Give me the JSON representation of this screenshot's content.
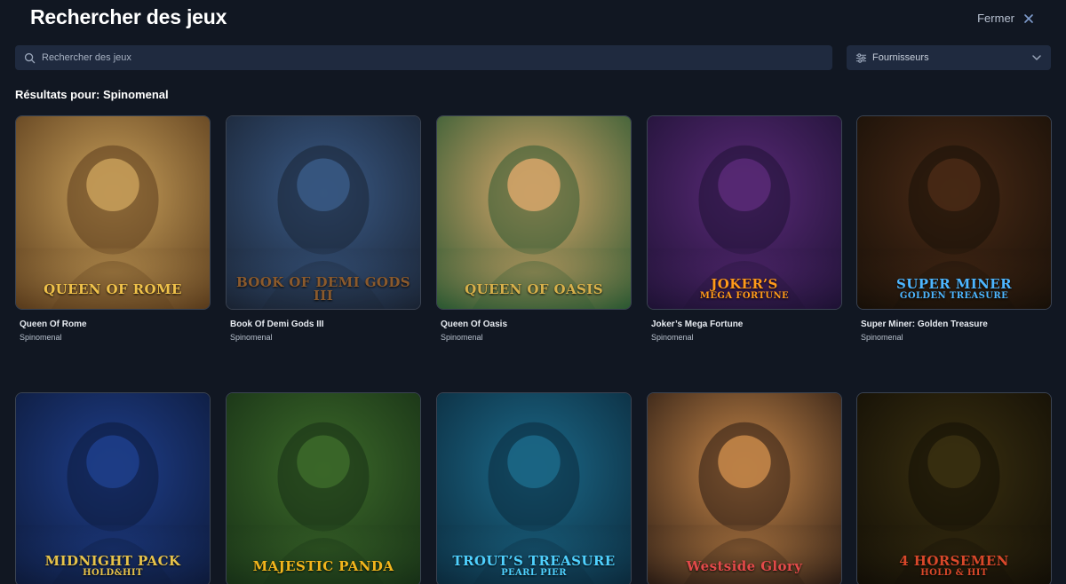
{
  "header": {
    "title": "Rechercher des jeux",
    "close_label": "Fermer"
  },
  "search": {
    "placeholder": "Rechercher des jeux",
    "value": ""
  },
  "filter": {
    "label": "Fournisseurs"
  },
  "results": {
    "heading": "Résultats pour: Spinomenal"
  },
  "games": [
    {
      "name": "Queen Of Rome",
      "provider": "Spinomenal",
      "art_title": "QUEEN OF ROME",
      "art_subtitle": "",
      "colors": [
        "#c9a05a",
        "#5b3d1d",
        "#f0c24a"
      ]
    },
    {
      "name": "Book Of Demi Gods III",
      "provider": "Spinomenal",
      "art_title": "BOOK OF DEMI GODS III",
      "art_subtitle": "",
      "colors": [
        "#3a5a86",
        "#1a2434",
        "#8b5a2c"
      ]
    },
    {
      "name": "Queen Of Oasis",
      "provider": "Spinomenal",
      "art_title": "QUEEN OF OASIS",
      "art_subtitle": "",
      "colors": [
        "#d9a76b",
        "#2f5a33",
        "#d7b04a"
      ]
    },
    {
      "name": "Joker’s Mega Fortune",
      "provider": "Spinomenal",
      "art_title": "JOKER’S",
      "art_subtitle": "MEGA FORTUNE",
      "colors": [
        "#5a2a78",
        "#1f1235",
        "#ff9a1a"
      ]
    },
    {
      "name": "Super Miner: Golden Treasure",
      "provider": "Spinomenal",
      "art_title": "SUPER MINER",
      "art_subtitle": "GOLDEN TREASURE",
      "colors": [
        "#4a2a16",
        "#181008",
        "#4db6ff"
      ]
    },
    {
      "name": "",
      "provider": "",
      "art_title": "MIDNIGHT PACK",
      "art_subtitle": "HOLD&HIT",
      "colors": [
        "#1f3f8c",
        "#0d1a3a",
        "#e7c34a"
      ]
    },
    {
      "name": "",
      "provider": "",
      "art_title": "MAJESTIC PANDA",
      "art_subtitle": "",
      "colors": [
        "#3d6b2a",
        "#173016",
        "#f2b51c"
      ]
    },
    {
      "name": "",
      "provider": "",
      "art_title": "TROUT’S TREASURE",
      "art_subtitle": "PEARL PIER",
      "colors": [
        "#1c6a8a",
        "#0b2a3c",
        "#4fd1ff"
      ]
    },
    {
      "name": "",
      "provider": "",
      "art_title": "Westside Glory",
      "art_subtitle": "",
      "colors": [
        "#c9894a",
        "#2b1c14",
        "#e34a4a"
      ]
    },
    {
      "name": "",
      "provider": "",
      "art_title": "4 HORSEMEN",
      "art_subtitle": "HOLD & HIT",
      "colors": [
        "#3a3010",
        "#120e06",
        "#d9482a"
      ]
    }
  ]
}
